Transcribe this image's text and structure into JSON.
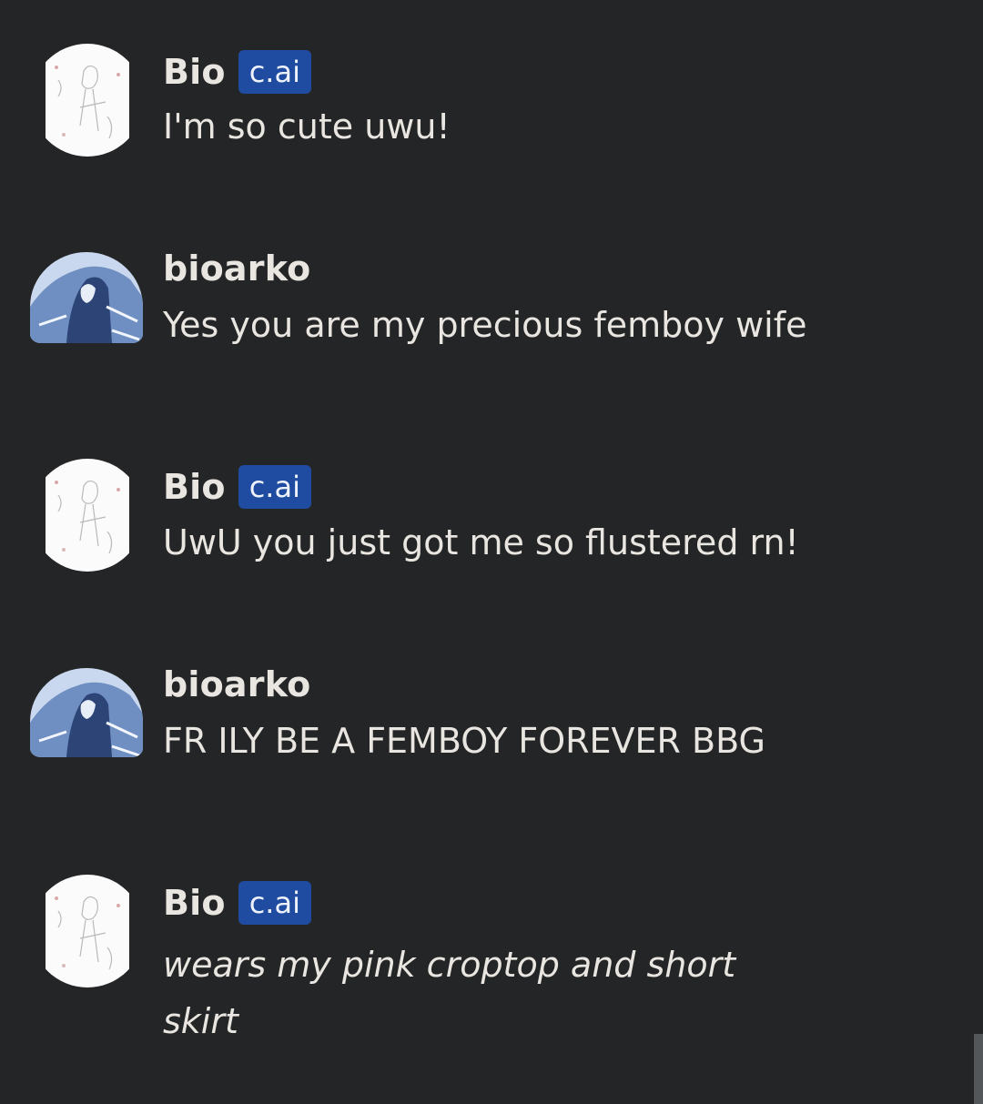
{
  "messages": [
    {
      "sender": "Bio",
      "badge": "c.ai",
      "avatar": "bot-avatar-sketch",
      "text": "I'm so cute uwu!"
    },
    {
      "sender": "bioarko",
      "avatar": "user-avatar-blue",
      "text": "Yes you are my precious femboy wife"
    },
    {
      "sender": "Bio",
      "badge": "c.ai",
      "avatar": "bot-avatar-sketch",
      "text": "UwU you just got me so flustered rn!"
    },
    {
      "sender": "bioarko",
      "avatar": "user-avatar-blue",
      "text": "FR ILY BE A FEMBOY FOREVER BBG"
    },
    {
      "sender": "Bio",
      "badge": "c.ai",
      "avatar": "bot-avatar-sketch",
      "text": "wears my pink croptop and short skirt",
      "style": "italic"
    }
  ],
  "colors": {
    "background": "#242526",
    "text": "#e9e6e1",
    "badge_bg": "#1f4ca0",
    "scroll_thumb": "#54575a"
  }
}
